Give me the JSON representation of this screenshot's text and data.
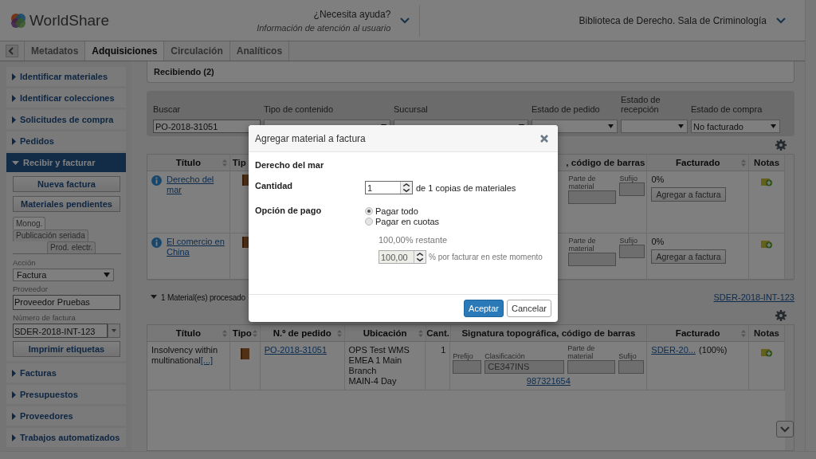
{
  "header": {
    "logo": "WorldShare",
    "help": {
      "label": "¿Necesita ayuda?",
      "subtitle": "Información de atención al usuario"
    },
    "institution": "Biblioteca de Derecho. Sala de Criminología"
  },
  "nav_tabs": [
    {
      "label": "Metadatos",
      "selected": false
    },
    {
      "label": "Adquisiciones",
      "selected": true
    },
    {
      "label": "Circulación",
      "selected": false
    },
    {
      "label": "Analíticos",
      "selected": false
    }
  ],
  "sidebar": {
    "items": [
      {
        "label": "Identificar materiales",
        "expanded": false
      },
      {
        "label": "Identificar colecciones",
        "expanded": false
      },
      {
        "label": "Solicitudes de compra",
        "expanded": false
      },
      {
        "label": "Pedidos",
        "expanded": false
      },
      {
        "label": "Recibir y facturar",
        "expanded": true
      },
      {
        "label": "Facturas",
        "expanded": false
      },
      {
        "label": "Presupuestos",
        "expanded": false
      },
      {
        "label": "Proveedores",
        "expanded": false
      },
      {
        "label": "Trabajos automatizados",
        "expanded": false
      }
    ],
    "panel": {
      "buttons": [
        "Nueva factura",
        "Materiales pendientes"
      ],
      "tabs": [
        {
          "label": "Monog.",
          "selected": true
        },
        {
          "label": "Publicación seriada",
          "selected": false
        },
        {
          "label": "Prod. electr.",
          "selected": false
        }
      ],
      "action": {
        "label": "Acción",
        "value": "Factura"
      },
      "vendor": {
        "label": "Proveedor",
        "value": "Proveedor Pruebas"
      },
      "invoice": {
        "label": "Número de factura",
        "value": "SDER-2018-INT-123"
      },
      "print_button": "Imprimir etiquetas"
    }
  },
  "receiving": {
    "title": "Recibiendo (2)"
  },
  "filters": [
    {
      "label": "Buscar",
      "kind": "text",
      "value": "PO-2018-31051"
    },
    {
      "label": "Tipo de contenido",
      "kind": "select"
    },
    {
      "label": "Sucursal",
      "kind": "select"
    },
    {
      "label": "Estado de pedido",
      "kind": "select"
    },
    {
      "label": "Estado de recepción",
      "kind": "select"
    },
    {
      "label": "Estado de compra",
      "kind": "select",
      "value": "No facturado"
    }
  ],
  "top_table": {
    "columns": [
      {
        "label": "Título",
        "sortable": true
      },
      {
        "label": "Tip",
        "sortable": false
      },
      {
        "label": ", código de barras",
        "sortable": false
      },
      {
        "label": "Facturado",
        "sortable": true
      },
      {
        "label": "Notas",
        "sortable": false
      }
    ],
    "rows": [
      {
        "title": "Derecho del mar",
        "part_label": "Parte de material",
        "suffix_label": "Sufijo",
        "billed": "0%",
        "action": "Agregar a factura"
      },
      {
        "title": "El comercio en China",
        "part_label": "Parte de material",
        "suffix_label": "Sufijo",
        "billed": "0%",
        "action": "Agregar a factura"
      }
    ]
  },
  "processed": {
    "label": "1 Material(es) procesado",
    "invoice_link": "SDER-2018-INT-123"
  },
  "bottom_table": {
    "columns": [
      {
        "label": "Título",
        "sortable": true
      },
      {
        "label": "Tipo",
        "sortable": true
      },
      {
        "label": "N.º de pedido",
        "sortable": true
      },
      {
        "label": "Ubicación",
        "sortable": true
      },
      {
        "label": "Cant.",
        "sortable": false
      },
      {
        "label": "Signatura topográfica, código de barras",
        "sortable": false
      },
      {
        "label": "Facturado",
        "sortable": true
      },
      {
        "label": "Notas",
        "sortable": false
      }
    ],
    "rows": [
      {
        "title": "Insolvency within multinational",
        "more": "[...]",
        "order": "PO-2018-31051",
        "location": [
          "OPS Test WMS",
          "EMEA 1 Main",
          "Branch",
          "MAIN-4 Day"
        ],
        "quantity": "1",
        "prefix_label": "Prefijo",
        "class_label": "Clasificación",
        "class_value": "CE347INS",
        "part_label": "Parte de material",
        "suffix_label": "Sufijo",
        "barcode": "987321654",
        "billed_link": "SDER-20...",
        "billed": "(100%)"
      }
    ]
  },
  "modal": {
    "title": "Agregar material a factura",
    "item_title": "Derecho del mar",
    "quantity": {
      "label": "Cantidad",
      "value": "1",
      "suffix": "de 1 copias de materiales"
    },
    "payment": {
      "label": "Opción de pago",
      "options": [
        {
          "label": "Pagar todo",
          "selected": true
        },
        {
          "label": "Pagar en cuotas",
          "selected": false
        }
      ],
      "remaining": "100,00% restante",
      "percent": {
        "value": "100,00",
        "suffix": "% por facturar en este momento"
      }
    },
    "buttons": [
      {
        "label": "Aceptar",
        "kind": "primary"
      },
      {
        "label": "Cancelar",
        "kind": "secondary"
      }
    ]
  }
}
